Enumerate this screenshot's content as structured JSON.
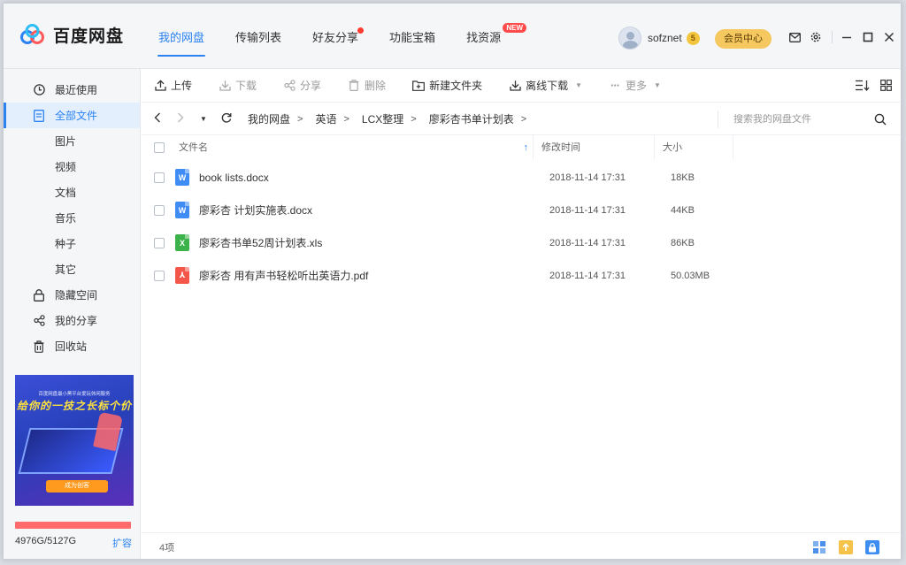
{
  "app": {
    "logo_text": "百度网盘"
  },
  "nav": [
    {
      "label": "我的网盘",
      "active": true
    },
    {
      "label": "传输列表"
    },
    {
      "label": "好友分享",
      "dot": true
    },
    {
      "label": "功能宝箱"
    },
    {
      "label": "找资源",
      "badge": "NEW"
    }
  ],
  "user": {
    "name": "sofznet",
    "level": "5",
    "vip_label": "会员中心"
  },
  "sidebar": {
    "items": [
      {
        "label": "最近使用",
        "icon": "clock-icon"
      },
      {
        "label": "全部文件",
        "icon": "document-icon",
        "active": true
      },
      {
        "label": "图片",
        "sub": true
      },
      {
        "label": "视频",
        "sub": true
      },
      {
        "label": "文档",
        "sub": true
      },
      {
        "label": "音乐",
        "sub": true
      },
      {
        "label": "种子",
        "sub": true
      },
      {
        "label": "其它",
        "sub": true
      },
      {
        "label": "隐藏空间",
        "icon": "lock-icon"
      },
      {
        "label": "我的分享",
        "icon": "share-icon"
      },
      {
        "label": "回收站",
        "icon": "trash-icon"
      }
    ],
    "ad": {
      "top_text": "百度网盘最小黑平台爱玩休闲服务",
      "title": "给你的一技之长标个价",
      "cta": "成为创客"
    },
    "quota": {
      "used_fraction": 0.97,
      "text": "4976G/5127G",
      "expand_label": "扩容"
    }
  },
  "toolbar": {
    "upload": "上传",
    "download": "下载",
    "share": "分享",
    "delete": "删除",
    "new_folder": "新建文件夹",
    "offline_download": "离线下载",
    "more": "更多"
  },
  "path": {
    "crumbs": [
      "我的网盘",
      "英语",
      "LCX整理",
      "廖彩杏书单计划表"
    ],
    "search_placeholder": "搜索我的网盘文件"
  },
  "table": {
    "headers": {
      "name": "文件名",
      "date": "修改时间",
      "size": "大小"
    },
    "rows": [
      {
        "type": "word",
        "icon_letter": "W",
        "name": "book lists.docx",
        "date": "2018-11-14 17:31",
        "size": "18KB"
      },
      {
        "type": "word",
        "icon_letter": "W",
        "name": "廖彩杏 计划实施表.docx",
        "date": "2018-11-14 17:31",
        "size": "44KB"
      },
      {
        "type": "excel",
        "icon_letter": "X",
        "name": "廖彩杏书单52周计划表.xls",
        "date": "2018-11-14 17:31",
        "size": "86KB"
      },
      {
        "type": "pdf",
        "icon_letter": "⅄",
        "name": "廖彩杏 用有声书轻松听出英语力.pdf",
        "date": "2018-11-14 17:31",
        "size": "50.03MB"
      }
    ]
  },
  "status": {
    "count_text": "4项"
  },
  "colors": {
    "accent": "#2b82f0",
    "word": "#3f8cf5",
    "excel": "#3bb34a",
    "pdf": "#f5564a",
    "quota": "#ff6b6b",
    "vip": "#f5c860"
  }
}
